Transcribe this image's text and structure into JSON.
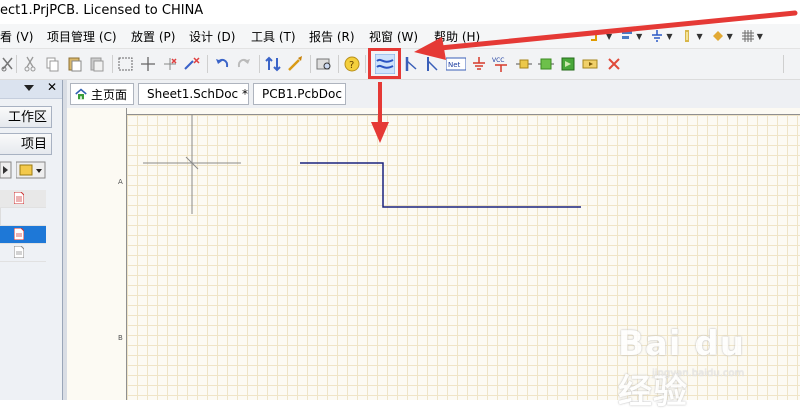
{
  "window": {
    "title": "ect1.PrjPCB. Licensed to CHINA"
  },
  "menu": [
    {
      "label": "看 (V)"
    },
    {
      "label": "项目管理 (C)"
    },
    {
      "label": "放置 (P)"
    },
    {
      "label": "设计 (D)"
    },
    {
      "label": "工具 (T)"
    },
    {
      "label": "报告 (R)"
    },
    {
      "label": "视窗 (W)"
    },
    {
      "label": "帮助 (H)"
    }
  ],
  "toolbar": {
    "highlighted_tool": "wire-icon",
    "tools": [
      "cut-icon",
      "copy-icon",
      "paste-icon",
      "paste-array-icon",
      "select-icon",
      "move-icon",
      "deselect-icon",
      "clear-filter-icon",
      "undo-icon",
      "redo-icon",
      "hierarchy-icon",
      "cross-probe-icon",
      "browse-library-icon",
      "help-icon",
      "wire-icon",
      "bus-icon",
      "bus-entry-icon",
      "net-label-icon",
      "gnd-port-icon",
      "vcc-port-icon",
      "place-part-icon",
      "sheet-symbol-icon",
      "sheet-entry-icon",
      "device-sheet-icon",
      "port-icon",
      "no-erc-icon"
    ],
    "net_label": "Net",
    "vcc_label": "VCC"
  },
  "left_panel": {
    "buttons": [
      "工作区",
      "项目"
    ]
  },
  "tabs": [
    {
      "label": "主页面"
    },
    {
      "label": "Sheet1.SchDoc *"
    },
    {
      "label": "PCB1.PcbDoc"
    }
  ],
  "sheet": {
    "zone_labels": [
      "A",
      "B"
    ]
  },
  "watermark": {
    "brand": "Bai du 经验",
    "url": "jingyan.baidu.com"
  },
  "colors": {
    "annotation": "#e53935",
    "selection": "#1e78d7",
    "wire": "#1a237e"
  }
}
